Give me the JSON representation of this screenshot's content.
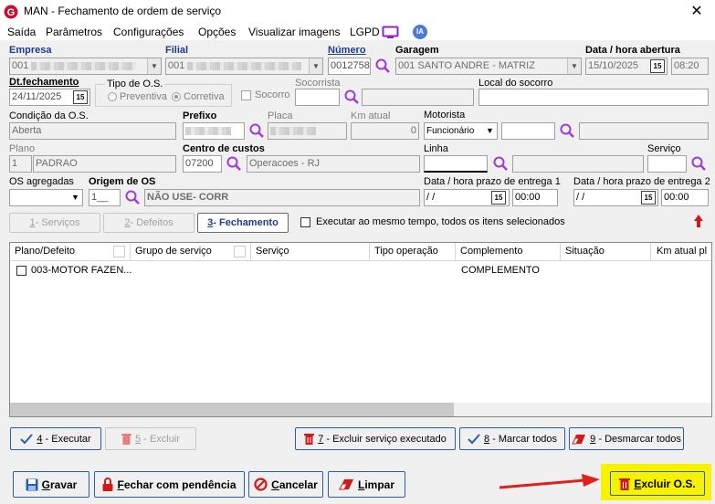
{
  "window": {
    "title": "MAN - Fechamento de ordem de serviço",
    "close_glyph": "✕"
  },
  "menu": [
    {
      "label": "Saída"
    },
    {
      "label": "Parâmetros"
    },
    {
      "label": "Configurações"
    },
    {
      "label": "Opções"
    },
    {
      "label": "Visualizar imagens"
    },
    {
      "label": "LGPD"
    }
  ],
  "ia_badge": "IA",
  "header": {
    "empresa_label": "Empresa",
    "empresa_value": "001",
    "filial_label": "Filial",
    "filial_value": "001",
    "numero_label": "Número",
    "numero_value": "0012758",
    "garagem_label": "Garagem",
    "garagem_value": "001 SANTO ANDRE - MATRIZ",
    "abertura_label": "Data / hora abertura",
    "abertura_date": "15/10/2025",
    "abertura_time": "08:20"
  },
  "row2": {
    "dtfech_label": "Dt.fechamento",
    "dtfech_value": "24/11/2025",
    "tipo_label": "Tipo de O.S.",
    "preventiva": "Preventiva",
    "corretiva": "Corretiva",
    "socorro": "Socorro",
    "socorrista_label": "Socorrista",
    "local_label": "Local do socorro"
  },
  "row3": {
    "condicao_label": "Condição da O.S.",
    "condicao_value": "Aberta",
    "prefixo_label": "Prefixo",
    "placa_label": "Placa",
    "km_label": "Km atual",
    "km_value": "0",
    "motorista_label": "Motorista",
    "motorista_value": "Funcionário"
  },
  "row4": {
    "plano_label": "Plano",
    "plano_code": "1",
    "plano_value": "PADRAO",
    "centro_label": "Centro de custos",
    "centro_code": "07200",
    "centro_value": "Operacoes - RJ",
    "linha_label": "Linha",
    "servico_label": "Serviço"
  },
  "row5": {
    "agregadas_label": "OS agregadas",
    "origem_label": "Origem de OS",
    "origem_code": "1__",
    "origem_value": "NÃO USE- CORR",
    "prazo1_label": "Data / hora prazo de entrega 1",
    "prazo1_date": " /  /",
    "prazo1_time": "00:00",
    "prazo2_label": "Data / hora prazo de entrega 2",
    "prazo2_date": " /  /",
    "prazo2_time": "00:00"
  },
  "tabs": [
    {
      "num": "1",
      "label": " - Serviços"
    },
    {
      "num": "2",
      "label": " - Defeitos"
    },
    {
      "num": "3",
      "label": " - Fechamento"
    }
  ],
  "exec_all_label": "Executar ao mesmo tempo, todos os itens selecionados",
  "table": {
    "columns": [
      "Plano/Defeito",
      "Grupo de serviço",
      "Serviço",
      "Tipo operação",
      "Complemento",
      "Situação",
      "Km atual pl"
    ],
    "rows": [
      {
        "plano": "003-MOTOR FAZEN...",
        "complemento": "COMPLEMENTO"
      }
    ]
  },
  "actions": {
    "executar": {
      "num": "4",
      "label": " - Executar"
    },
    "excluir": {
      "num": "5",
      "label": " - Excluir"
    },
    "excluir_exec": {
      "num": "7",
      "label": " - Excluir serviço executado"
    },
    "marcar": {
      "num": "8",
      "label": " - Marcar todos"
    },
    "desmarcar": {
      "num": "9",
      "label": " - Desmarcar todos"
    }
  },
  "footer": {
    "gravar": {
      "u": "G",
      "rest": "ravar"
    },
    "pendencia": {
      "u": "F",
      "rest": "echar com pendência"
    },
    "cancelar": {
      "u": "C",
      "rest": "ancelar"
    },
    "limpar": {
      "u": "L",
      "rest": "impar"
    },
    "excluir_os": {
      "u": "E",
      "rest": "xcluir O.S."
    }
  },
  "colors": {
    "accent_blue": "#1f3c88",
    "highlight_yellow": "#f7f300",
    "arrow_red": "#e0201c",
    "trash_red": "#d11a1a"
  }
}
